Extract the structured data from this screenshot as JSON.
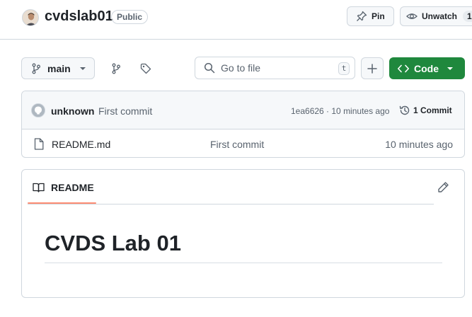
{
  "repo": {
    "name": "cvdslab01",
    "visibility": "Public"
  },
  "header_actions": {
    "pin_label": "Pin",
    "unwatch_label": "Unwatch",
    "watch_count": "1"
  },
  "toolbar": {
    "branch": "main",
    "search_placeholder": "Go to file",
    "search_shortcut": "t",
    "code_label": "Code"
  },
  "latest_commit": {
    "author": "unknown",
    "message": "First commit",
    "meta": "1ea6626 · 10 minutes ago",
    "count_label": "1 Commit"
  },
  "files": [
    {
      "name": "README.md",
      "commit": "First commit",
      "time": "10 minutes ago"
    }
  ],
  "readme": {
    "tab_label": "README",
    "heading": "CVDS Lab 01"
  },
  "colors": {
    "accent_green": "#1f883d",
    "tab_underline": "#fd8c73",
    "border": "#d0d7de"
  }
}
